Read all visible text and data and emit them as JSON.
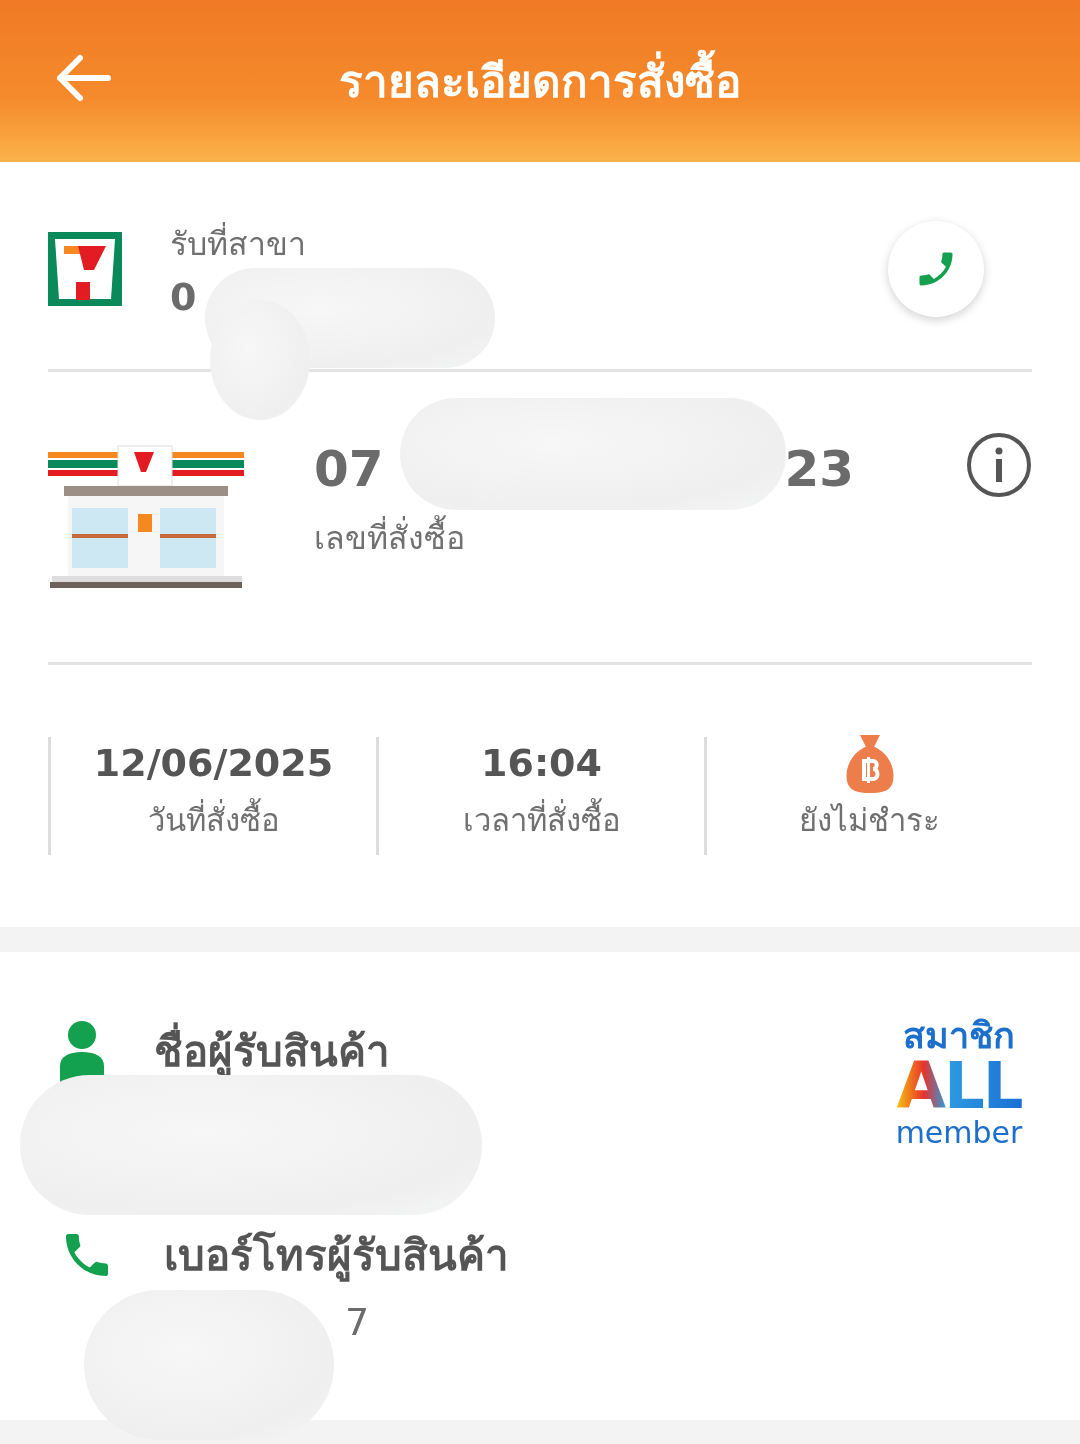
{
  "header": {
    "title": "รายละเอียดการสั่งซื้อ"
  },
  "pickup": {
    "label": "รับที่สาขา",
    "branch": "0"
  },
  "order": {
    "number_start": "07",
    "number_end": "23",
    "label": "เลขที่สั่งซื้อ"
  },
  "summary": [
    {
      "kind": "text",
      "value": "12/06/2025",
      "label": "วันที่สั่งซื้อ"
    },
    {
      "kind": "text",
      "value": "16:04",
      "label": "เวลาที่สั่งซื้อ"
    },
    {
      "kind": "icon",
      "label": "ยังไม่ชำระ"
    }
  ],
  "recipient": {
    "name_label": "ชื่อผู้รับสินค้า",
    "phone_label": "เบอร์โทรผู้รับสินค้า",
    "phone": "7"
  },
  "badge": {
    "top": "สมาชิก",
    "main": "ALL",
    "bottom": "member"
  }
}
